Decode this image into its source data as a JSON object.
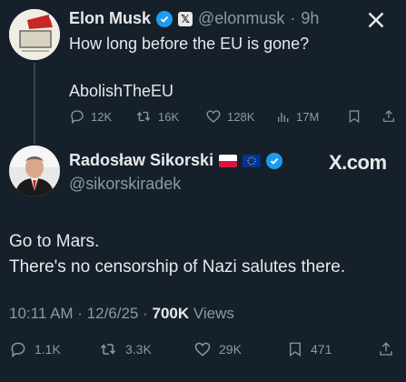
{
  "tweet1": {
    "name": "Elon Musk",
    "handle": "@elonmusk",
    "separator": "·",
    "time": "9h",
    "text_line1": "How long before the EU is gone?",
    "text_line2": "AbolishTheEU",
    "actions": {
      "replies": "12K",
      "reposts": "16K",
      "likes": "128K",
      "views": "17M"
    }
  },
  "tweet2": {
    "name": "Radosław Sikorski",
    "handle": "@sikorskiradek",
    "watermark": "X.com",
    "text_line1": "Go to Mars.",
    "text_line2": "There's no censorship of Nazi salutes there.",
    "timestamp": "10:11 AM · 12/6/25 · ",
    "views_count": "700K",
    "views_label": " Views",
    "actions": {
      "replies": "1.1K",
      "reposts": "3.3K",
      "likes": "29K",
      "bookmarks": "471"
    }
  },
  "colors": {
    "background": "#15202b",
    "text": "#e7e9ea",
    "muted": "#8b98a5",
    "verified": "#1d9bf0"
  }
}
